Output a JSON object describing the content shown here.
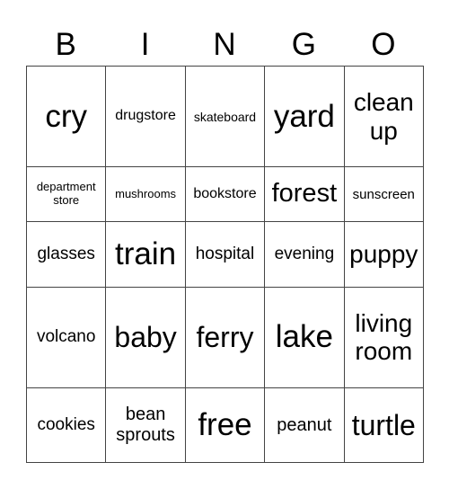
{
  "header": [
    "B",
    "I",
    "N",
    "G",
    "O"
  ],
  "rows": [
    [
      "cry",
      "drugstore",
      "skateboard",
      "yard",
      "clean up"
    ],
    [
      "department store",
      "mushrooms",
      "bookstore",
      "forest",
      "sunscreen"
    ],
    [
      "glasses",
      "train",
      "hospital",
      "evening",
      "puppy"
    ],
    [
      "volcano",
      "baby",
      "ferry",
      "lake",
      "living room"
    ],
    [
      "cookies",
      "bean sprouts",
      "free",
      "peanut",
      "turtle"
    ]
  ]
}
